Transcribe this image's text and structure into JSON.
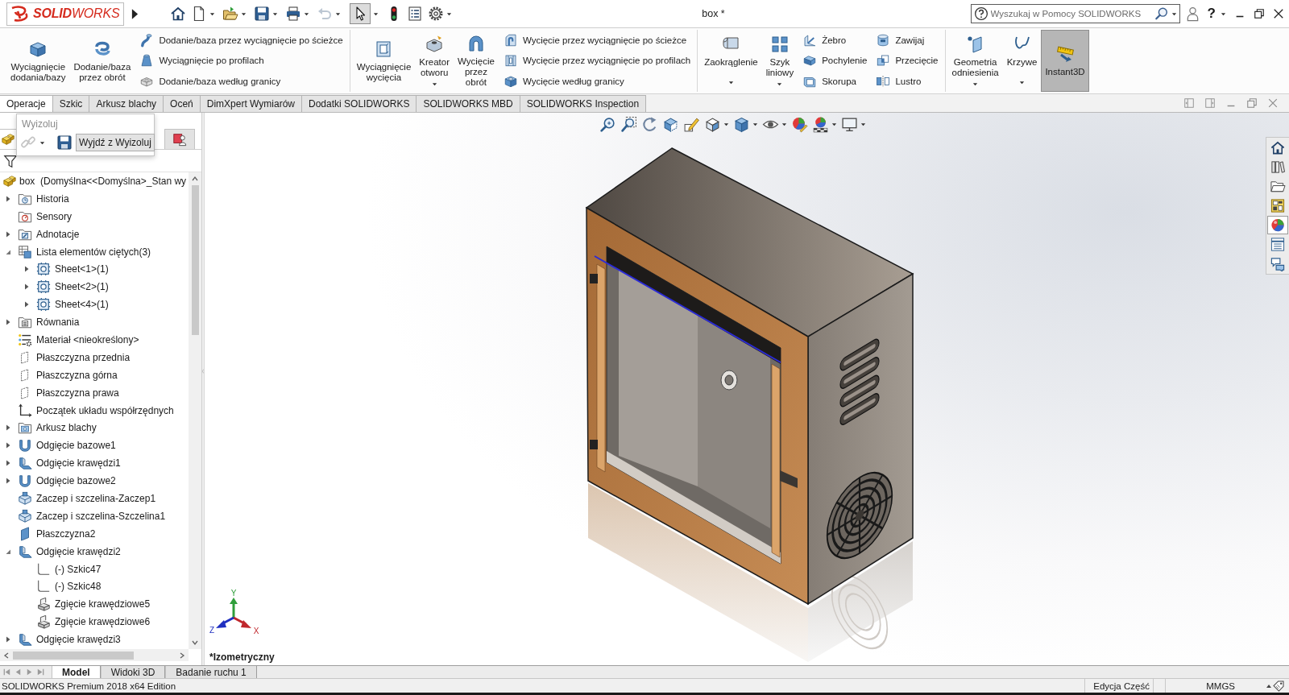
{
  "title_bar": {
    "logo": "**SOLID**WORKS",
    "document_title": "box *",
    "search": {
      "placeholder": "Wyszukaj w Pomocy SOLIDWORKS"
    },
    "help": "?"
  },
  "quick_access": {
    "undo": {
      "disabled": true
    },
    "select": {
      "selected": true
    }
  },
  "ribbon": {
    "groups": [
      {
        "items": [
          {
            "kind": "large",
            "label": "Wyciągnięcie dodania/bazy"
          },
          {
            "kind": "large",
            "label": "Dodanie/baza przez obrót"
          },
          {
            "kind": "column",
            "items": [
              {
                "label": "Dodanie/baza przez wyciągnięcie po ścieżce"
              },
              {
                "label": "Wyciągnięcie po profilach"
              },
              {
                "label": "Dodanie/baza według granicy"
              }
            ]
          }
        ]
      },
      {
        "items": [
          {
            "kind": "large",
            "label": "Wyciągnięcie wycięcia"
          },
          {
            "kind": "large",
            "label": "Kreator otworu",
            "dropdown": true
          },
          {
            "kind": "large",
            "label": "Wycięcie przez obrót"
          },
          {
            "kind": "column",
            "items": [
              {
                "label": "Wycięcie przez wyciągnięcie po ścieżce"
              },
              {
                "label": "Wycięcie przez wyciągnięcie po profilach"
              },
              {
                "label": "Wycięcie według granicy"
              }
            ]
          }
        ]
      },
      {
        "items": [
          {
            "kind": "large",
            "label": "Zaokrąglenie",
            "dropdown": true
          },
          {
            "kind": "large",
            "label": "Szyk liniowy",
            "dropdown": true
          },
          {
            "kind": "column",
            "items": [
              {
                "label": "Żebro"
              },
              {
                "label": "Pochylenie"
              },
              {
                "label": "Skorupa"
              }
            ]
          },
          {
            "kind": "column",
            "items": [
              {
                "label": "Zawijaj"
              },
              {
                "label": "Przecięcie"
              },
              {
                "label": "Lustro"
              }
            ]
          }
        ]
      },
      {
        "items": [
          {
            "kind": "large",
            "label": "Geometria odniesienia",
            "dropdown": true
          },
          {
            "kind": "large",
            "label": "Krzywe",
            "dropdown": true
          },
          {
            "kind": "toggle",
            "label": "Instant3D",
            "on": true
          }
        ]
      }
    ]
  },
  "command_tabs": [
    {
      "label": "Operacje",
      "selected": true
    },
    {
      "label": "Szkic",
      "selected": false
    },
    {
      "label": "Arkusz blachy",
      "selected": false
    },
    {
      "label": "Oceń",
      "selected": false
    },
    {
      "label": "DimXpert Wymiarów",
      "selected": false
    },
    {
      "label": "Dodatki SOLIDWORKS",
      "selected": false
    },
    {
      "label": "SOLIDWORKS MBD",
      "selected": false
    },
    {
      "label": "SOLIDWORKS Inspection",
      "selected": false
    }
  ],
  "isolate_popup": {
    "title": "Wyizoluj",
    "visibility_tool": {
      "disabled": true
    },
    "exit_button": "Wyjdź z Wyizoluj"
  },
  "feature_manager": {
    "tabs": [
      {
        "selected": true
      },
      {
        "selected": false
      }
    ],
    "tree": {
      "root": {
        "kind": "part",
        "label": "box  (Domyślna<<Domyślna>_Stan wy",
        "children": [
          {
            "kind": "history",
            "label": "Historia",
            "expanded": false
          },
          {
            "kind": "sensors",
            "label": "Sensory"
          },
          {
            "kind": "annotations",
            "label": "Adnotacje",
            "expanded": false
          },
          {
            "kind": "cutlist",
            "label": "Lista elementów ciętych(3)",
            "expanded": true,
            "children": [
              {
                "kind": "sheet",
                "label": "Sheet<1>(1)",
                "expanded": false
              },
              {
                "kind": "sheet",
                "label": "Sheet<2>(1)",
                "expanded": false
              },
              {
                "kind": "sheet",
                "label": "Sheet<4>(1)",
                "expanded": false
              }
            ]
          },
          {
            "kind": "equations",
            "label": "Równania",
            "expanded": false
          },
          {
            "kind": "material",
            "label": "Materiał <nieokreślony>"
          },
          {
            "kind": "plane",
            "label": "Płaszczyzna przednia"
          },
          {
            "kind": "plane",
            "label": "Płaszczyzna górna"
          },
          {
            "kind": "plane",
            "label": "Płaszczyzna prawa"
          },
          {
            "kind": "origin",
            "label": "Początek układu współrzędnych"
          },
          {
            "kind": "sheetmetal",
            "label": "Arkusz blachy",
            "expanded": false
          },
          {
            "kind": "baseflange",
            "label": "Odgięcie bazowe1",
            "expanded": false
          },
          {
            "kind": "edgeflange",
            "label": "Odgięcie krawędzi1",
            "expanded": false
          },
          {
            "kind": "baseflange",
            "label": "Odgięcie bazowe2",
            "expanded": false
          },
          {
            "kind": "tabslot",
            "label": "Zaczep i szczelina-Zaczep1"
          },
          {
            "kind": "tabslot",
            "label": "Zaczep i szczelina-Szczelina1"
          },
          {
            "kind": "refplane",
            "label": "Płaszczyzna2"
          },
          {
            "kind": "edgeflange",
            "label": "Odgięcie krawędzi2",
            "expanded": true,
            "children": [
              {
                "kind": "sketch",
                "label": "(-) Szkic47"
              },
              {
                "kind": "sketch",
                "label": "(-) Szkic48"
              },
              {
                "kind": "bend",
                "label": "Zgięcie krawędziowe5"
              },
              {
                "kind": "bend",
                "label": "Zgięcie krawędziowe6"
              }
            ]
          },
          {
            "kind": "edgeflange",
            "label": "Odgięcie krawędzi3",
            "expanded": false
          }
        ]
      }
    }
  },
  "viewport": {
    "view_name": "*Izometryczny",
    "triad": {
      "x": "X",
      "y": "Y",
      "z": "Z"
    }
  },
  "task_pane": [
    {
      "selected": false
    },
    {
      "selected": false
    },
    {
      "selected": false
    },
    {
      "selected": false
    },
    {
      "selected": true
    },
    {
      "selected": false
    },
    {
      "selected": false
    }
  ],
  "bottom_tabs": [
    {
      "label": "Model",
      "selected": true
    },
    {
      "label": "Widoki 3D",
      "selected": false
    },
    {
      "label": "Badanie ruchu 1",
      "selected": false
    }
  ],
  "status_bar": {
    "edition": "SOLIDWORKS Premium 2018 x64 Edition",
    "mode": "Edycja Część",
    "units": "MMGS"
  }
}
